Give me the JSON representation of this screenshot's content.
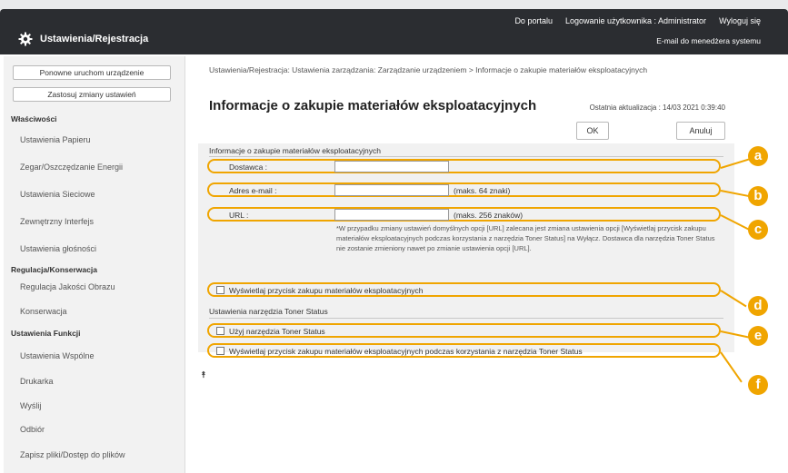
{
  "topbar": {
    "links": [
      "Do portalu",
      "Logowanie użytkownika :  Administrator",
      "Wyloguj się"
    ],
    "app_title": "Ustawienia/Rejestracja",
    "email_admin": "E-mail do menedżera systemu"
  },
  "sidebar": {
    "buttons": [
      "Ponowne uruchom urządzenie",
      "Zastosuj zmiany ustawień"
    ],
    "sections": [
      {
        "title": "Właściwości",
        "items": [
          "Ustawienia Papieru",
          "Zegar/Oszczędzanie Energii",
          "Ustawienia Sieciowe",
          "Zewnętrzny Interfejs",
          "Ustawienia głośności"
        ]
      },
      {
        "title": "Regulacja/Konserwacja",
        "items": [
          "Regulacja Jakości Obrazu",
          "Konserwacja"
        ]
      },
      {
        "title": "Ustawienia Funkcji",
        "items": [
          "Ustawienia Wspólne",
          "Drukarka",
          "Wyślij",
          "Odbiór",
          "Zapisz pliki/Dostęp do plików"
        ]
      }
    ]
  },
  "main": {
    "breadcrumb": "Ustawienia/Rejestracja: Ustawienia zarządzania: Zarządzanie urządzeniem > Informacje o zakupie materiałów eksploatacyjnych",
    "title": "Informacje o zakupie materiałów eksploatacyjnych",
    "last_update": "Ostatnia aktualizacja : 14/03 2021 0:39:40",
    "ok_label": "OK",
    "cancel_label": "Anuluj",
    "section1_title": "Informacje o zakupie materiałów eksploatacyjnych",
    "fields": {
      "supplier_label": "Dostawca :",
      "supplier_value": "",
      "email_label": "Adres e-mail :",
      "email_value": "",
      "email_note": "(maks. 64 znaki)",
      "url_label": "URL :",
      "url_value": "",
      "url_note": "(maks. 256 znaków)"
    },
    "info_note": "*W przypadku zmiany ustawień domyślnych opcji [URL] zalecana jest zmiana ustawienia opcji [Wyświetlaj przycisk zakupu materiałów eksploatacyjnych podczas korzystania z narzędzia Toner Status] na Wyłącz. Dostawca dla narzędzia Toner Status nie zostanie zmieniony nawet po zmianie ustawienia opcji [URL].",
    "checkbox_show_button": "Wyświetlaj przycisk zakupu materiałów eksploatacyjnych",
    "section2_title": "Ustawienia narzędzia Toner Status",
    "checkbox_use_toner": "Użyj narzędzia Toner Status",
    "checkbox_show_button_toner": "Wyświetlaj przycisk zakupu materiałów eksploatacyjnych podczas korzystania z narzędzia Toner Status",
    "scroll_top_mark": "⯭"
  },
  "markers": [
    "a",
    "b",
    "c",
    "d",
    "e",
    "f"
  ],
  "colors": {
    "accent": "#f0a500",
    "topbar": "#2b2d31",
    "panel": "#f1f1f1"
  }
}
